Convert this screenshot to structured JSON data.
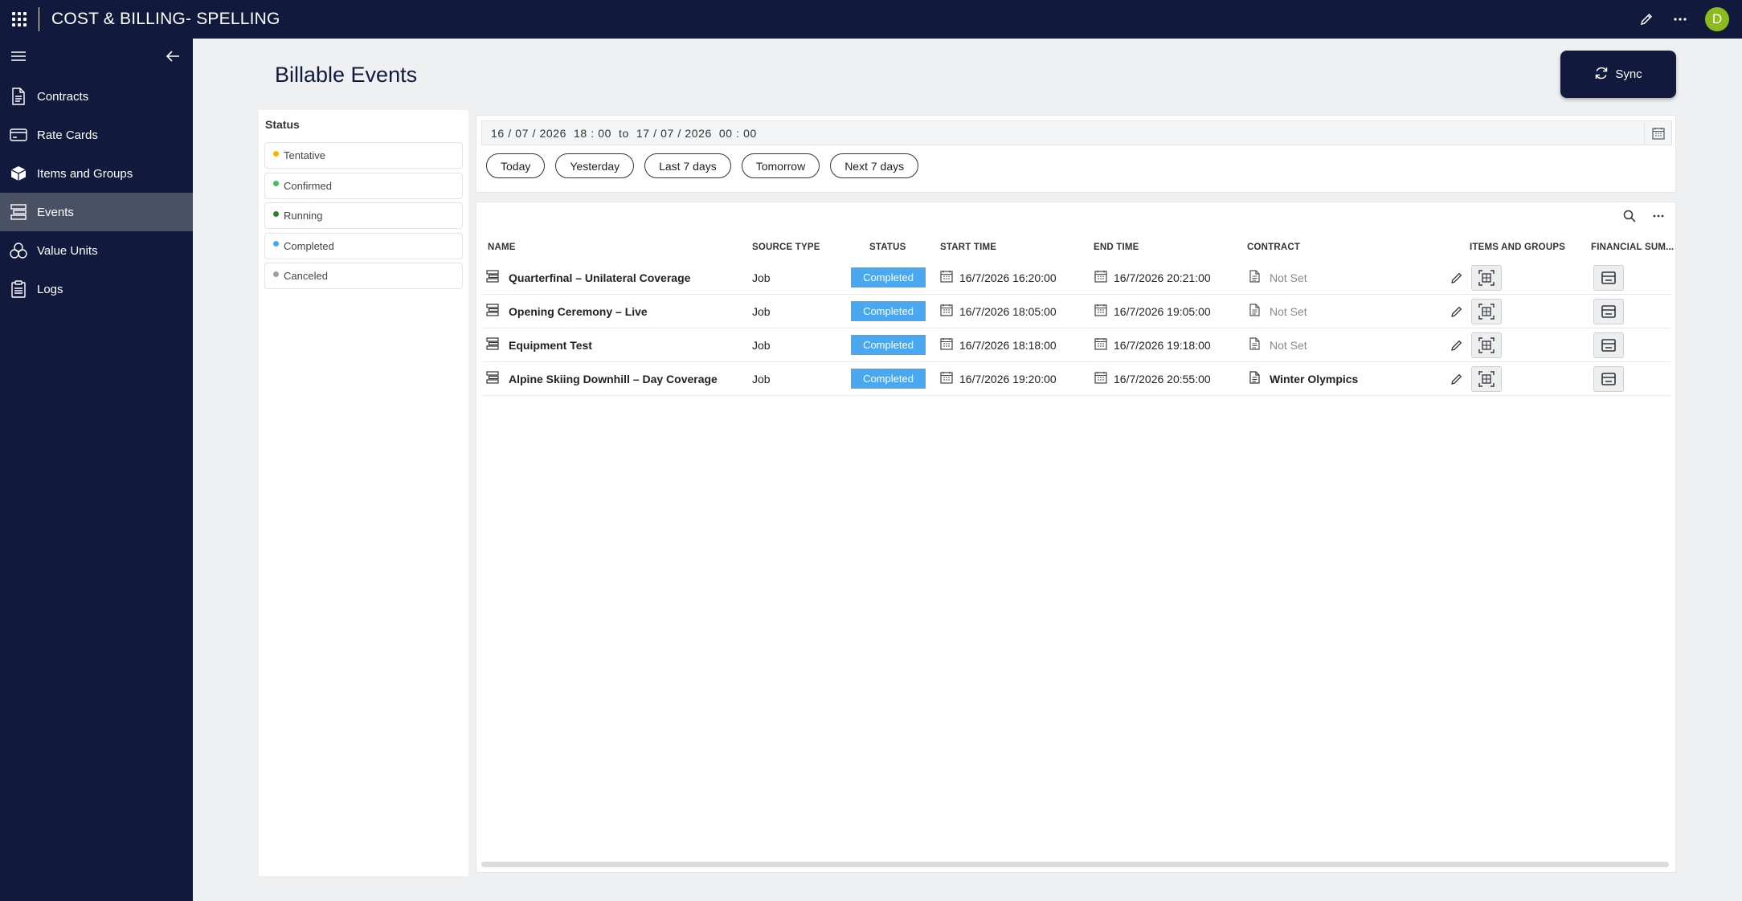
{
  "app": {
    "title": "COST & BILLING- SPELLING",
    "avatar_initial": "D"
  },
  "sidebar": {
    "items": [
      {
        "label": "Contracts",
        "icon": "document-icon"
      },
      {
        "label": "Rate Cards",
        "icon": "card-icon"
      },
      {
        "label": "Items and Groups",
        "icon": "box-icon"
      },
      {
        "label": "Events",
        "icon": "events-icon",
        "active": true
      },
      {
        "label": "Value Units",
        "icon": "coins-icon"
      },
      {
        "label": "Logs",
        "icon": "clipboard-icon"
      }
    ]
  },
  "page": {
    "title": "Billable Events",
    "sync_label": "Sync"
  },
  "status_filter": {
    "heading": "Status",
    "items": [
      {
        "label": "Tentative",
        "color": "#f5b400"
      },
      {
        "label": "Confirmed",
        "color": "#3fc05a"
      },
      {
        "label": "Running",
        "color": "#2e7d32"
      },
      {
        "label": "Completed",
        "color": "#4aa8f0"
      },
      {
        "label": "Canceled",
        "color": "#9e9e9e"
      }
    ]
  },
  "date_range": {
    "value": "16 / 07 / 2026  18 : 00  to  17 / 07 / 2026  00 : 00",
    "quick": [
      "Today",
      "Yesterday",
      "Last 7 days",
      "Tomorrow",
      "Next 7 days"
    ]
  },
  "table": {
    "columns": {
      "name": "NAME",
      "source_type": "SOURCE TYPE",
      "status": "STATUS",
      "start_time": "START TIME",
      "end_time": "END TIME",
      "contract": "CONTRACT",
      "items_groups": "ITEMS AND GROUPS",
      "financial": "FINANCIAL SUM..."
    },
    "rows": [
      {
        "name": "Quarterfinal – Unilateral Coverage",
        "source_type": "Job",
        "status": "Completed",
        "start": "16/7/2026 16:20:00",
        "end": "16/7/2026 20:21:00",
        "contract": "Not Set"
      },
      {
        "name": "Opening Ceremony – Live",
        "source_type": "Job",
        "status": "Completed",
        "start": "16/7/2026 18:05:00",
        "end": "16/7/2026 19:05:00",
        "contract": "Not Set"
      },
      {
        "name": "Equipment Test",
        "source_type": "Job",
        "status": "Completed",
        "start": "16/7/2026 18:18:00",
        "end": "16/7/2026 19:18:00",
        "contract": "Not Set"
      },
      {
        "name": "Alpine Skiing Downhill – Day Coverage",
        "source_type": "Job",
        "status": "Completed",
        "start": "16/7/2026 19:20:00",
        "end": "16/7/2026 20:55:00",
        "contract": "Winter Olympics"
      }
    ]
  }
}
